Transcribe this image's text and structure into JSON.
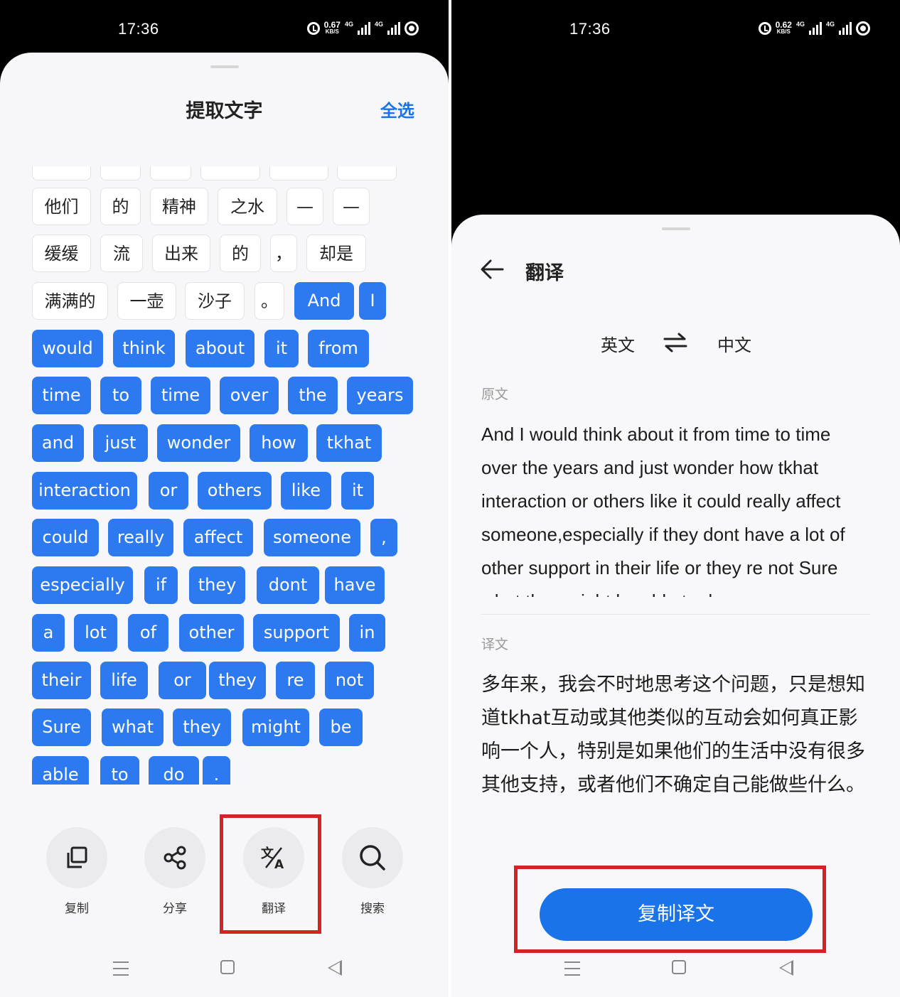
{
  "left": {
    "status": {
      "time": "17:36",
      "speed_value": "0.67",
      "speed_unit": "KB/S",
      "net1": "4G",
      "net2": "4G"
    },
    "title": "提取文字",
    "select_all": "全选",
    "chips": [
      {
        "text": "他们",
        "selected": false
      },
      {
        "text": "的",
        "selected": false
      },
      {
        "text": "精神",
        "selected": false
      },
      {
        "text": "之水",
        "selected": false
      },
      {
        "text": "—",
        "selected": false
      },
      {
        "text": "—",
        "selected": false
      },
      {
        "text": "缓缓",
        "selected": false
      },
      {
        "text": "流",
        "selected": false
      },
      {
        "text": "出来",
        "selected": false
      },
      {
        "text": "的",
        "selected": false
      },
      {
        "text": "，",
        "selected": false
      },
      {
        "text": "却是",
        "selected": false
      },
      {
        "text": "满满的",
        "selected": false
      },
      {
        "text": "一壶",
        "selected": false
      },
      {
        "text": "沙子",
        "selected": false
      },
      {
        "text": "。",
        "selected": false
      },
      {
        "text": "And",
        "selected": true
      },
      {
        "text": "I",
        "selected": true
      },
      {
        "text": "would",
        "selected": true
      },
      {
        "text": "think",
        "selected": true
      },
      {
        "text": "about",
        "selected": true
      },
      {
        "text": "it",
        "selected": true
      },
      {
        "text": "from",
        "selected": true
      },
      {
        "text": "time",
        "selected": true
      },
      {
        "text": "to",
        "selected": true
      },
      {
        "text": "time",
        "selected": true
      },
      {
        "text": "over",
        "selected": true
      },
      {
        "text": "the",
        "selected": true
      },
      {
        "text": "years",
        "selected": true
      },
      {
        "text": "and",
        "selected": true
      },
      {
        "text": "just",
        "selected": true
      },
      {
        "text": "wonder",
        "selected": true
      },
      {
        "text": "how",
        "selected": true
      },
      {
        "text": "tkhat",
        "selected": true
      },
      {
        "text": "interaction",
        "selected": true
      },
      {
        "text": "or",
        "selected": true
      },
      {
        "text": "others",
        "selected": true
      },
      {
        "text": "like",
        "selected": true
      },
      {
        "text": "it",
        "selected": true
      },
      {
        "text": "could",
        "selected": true
      },
      {
        "text": "really",
        "selected": true
      },
      {
        "text": "affect",
        "selected": true
      },
      {
        "text": "someone",
        "selected": true
      },
      {
        "text": ",",
        "selected": true
      },
      {
        "text": "especially",
        "selected": true
      },
      {
        "text": "if",
        "selected": true
      },
      {
        "text": "they",
        "selected": true
      },
      {
        "text": "dont",
        "selected": true
      },
      {
        "text": "have",
        "selected": true
      },
      {
        "text": "a",
        "selected": true
      },
      {
        "text": "lot",
        "selected": true
      },
      {
        "text": "of",
        "selected": true
      },
      {
        "text": "other",
        "selected": true
      },
      {
        "text": "support",
        "selected": true
      },
      {
        "text": "in",
        "selected": true
      },
      {
        "text": "their",
        "selected": true
      },
      {
        "text": "life",
        "selected": true
      },
      {
        "text": "or",
        "selected": true
      },
      {
        "text": "they",
        "selected": true
      },
      {
        "text": "re",
        "selected": true
      },
      {
        "text": "not",
        "selected": true
      },
      {
        "text": "Sure",
        "selected": true
      },
      {
        "text": "what",
        "selected": true
      },
      {
        "text": "they",
        "selected": true
      },
      {
        "text": "might",
        "selected": true
      },
      {
        "text": "be",
        "selected": true
      },
      {
        "text": "able",
        "selected": true
      },
      {
        "text": "to",
        "selected": true
      },
      {
        "text": "do",
        "selected": true
      },
      {
        "text": ".",
        "selected": true
      }
    ],
    "actions": [
      {
        "label": "复制",
        "icon": "copy-icon"
      },
      {
        "label": "分享",
        "icon": "share-icon"
      },
      {
        "label": "翻译",
        "icon": "translate-icon"
      },
      {
        "label": "搜索",
        "icon": "search-icon"
      }
    ]
  },
  "right": {
    "status": {
      "time": "17:36",
      "speed_value": "0.62",
      "speed_unit": "KB/S",
      "net1": "4G",
      "net2": "4G"
    },
    "title": "翻译",
    "source_lang": "英文",
    "target_lang": "中文",
    "source_label": "原文",
    "source_text": "And I would think about it from time to time over the years and just wonder how tkhat interaction or others like it could really affect someone,especially if they dont have a lot of other support in their life or they re not Sure what they might be able to do.",
    "target_label": "译文",
    "target_text": "多年来，我会不时地思考这个问题，只是想知道tkhat互动或其他类似的互动会如何真正影响一个人，特别是如果他们的生活中没有很多其他支持，或者他们不确定自己能做些什么。",
    "copy_button": "复制译文"
  },
  "colors": {
    "accent": "#2d79f0",
    "button": "#1a73e8",
    "highlight_box": "#d32424"
  }
}
